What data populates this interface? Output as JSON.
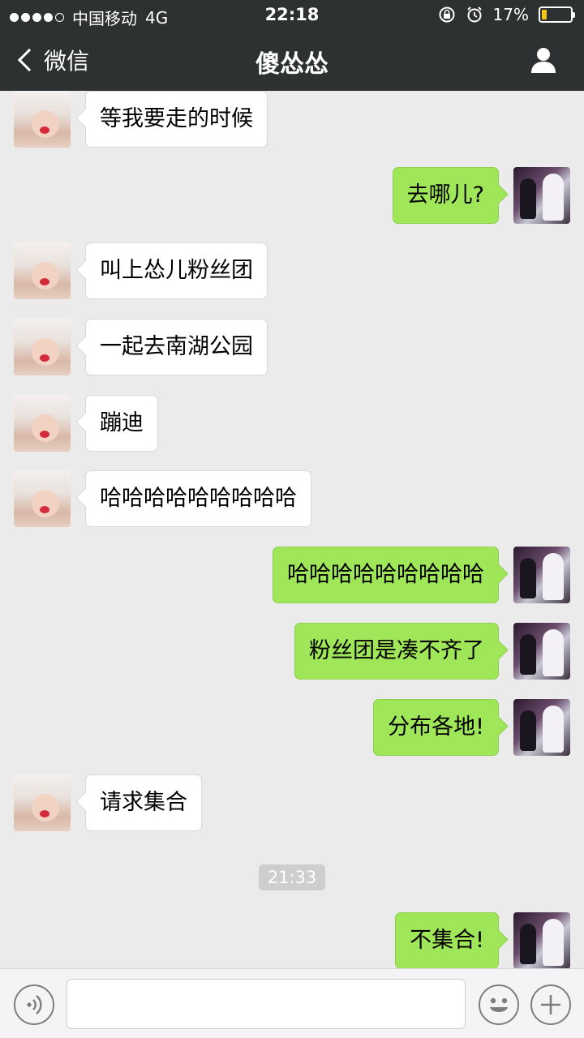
{
  "status_bar": {
    "carrier": "中国移动",
    "network": "4G",
    "time": "22:18",
    "battery_percent": "17%",
    "battery_level": 0.17
  },
  "nav": {
    "back_label": "微信",
    "title": "傻怂怂"
  },
  "messages": [
    {
      "side": "left",
      "text": "等我要走的时候"
    },
    {
      "side": "right",
      "text": "去哪儿?"
    },
    {
      "side": "left",
      "text": "叫上怂儿粉丝团"
    },
    {
      "side": "left",
      "text": "一起去南湖公园"
    },
    {
      "side": "left",
      "text": "蹦迪"
    },
    {
      "side": "left",
      "text": "哈哈哈哈哈哈哈哈哈"
    },
    {
      "side": "right",
      "text": "哈哈哈哈哈哈哈哈哈"
    },
    {
      "side": "right",
      "text": "粉丝团是凑不齐了"
    },
    {
      "side": "right",
      "text": "分布各地!"
    },
    {
      "side": "left",
      "text": "请求集合"
    },
    {
      "side": "right",
      "text": "不集合!"
    }
  ],
  "timestamp": "21:33",
  "input": {
    "value": "",
    "placeholder": ""
  },
  "icons": {
    "back": "chevron-left-icon",
    "profile": "person-icon",
    "voice": "voice-icon",
    "emoji": "emoji-icon",
    "plus": "plus-icon"
  },
  "colors": {
    "topbar": "#2e3132",
    "background": "#ebebeb",
    "sent_bubble": "#9fe658",
    "received_bubble": "#ffffff"
  }
}
